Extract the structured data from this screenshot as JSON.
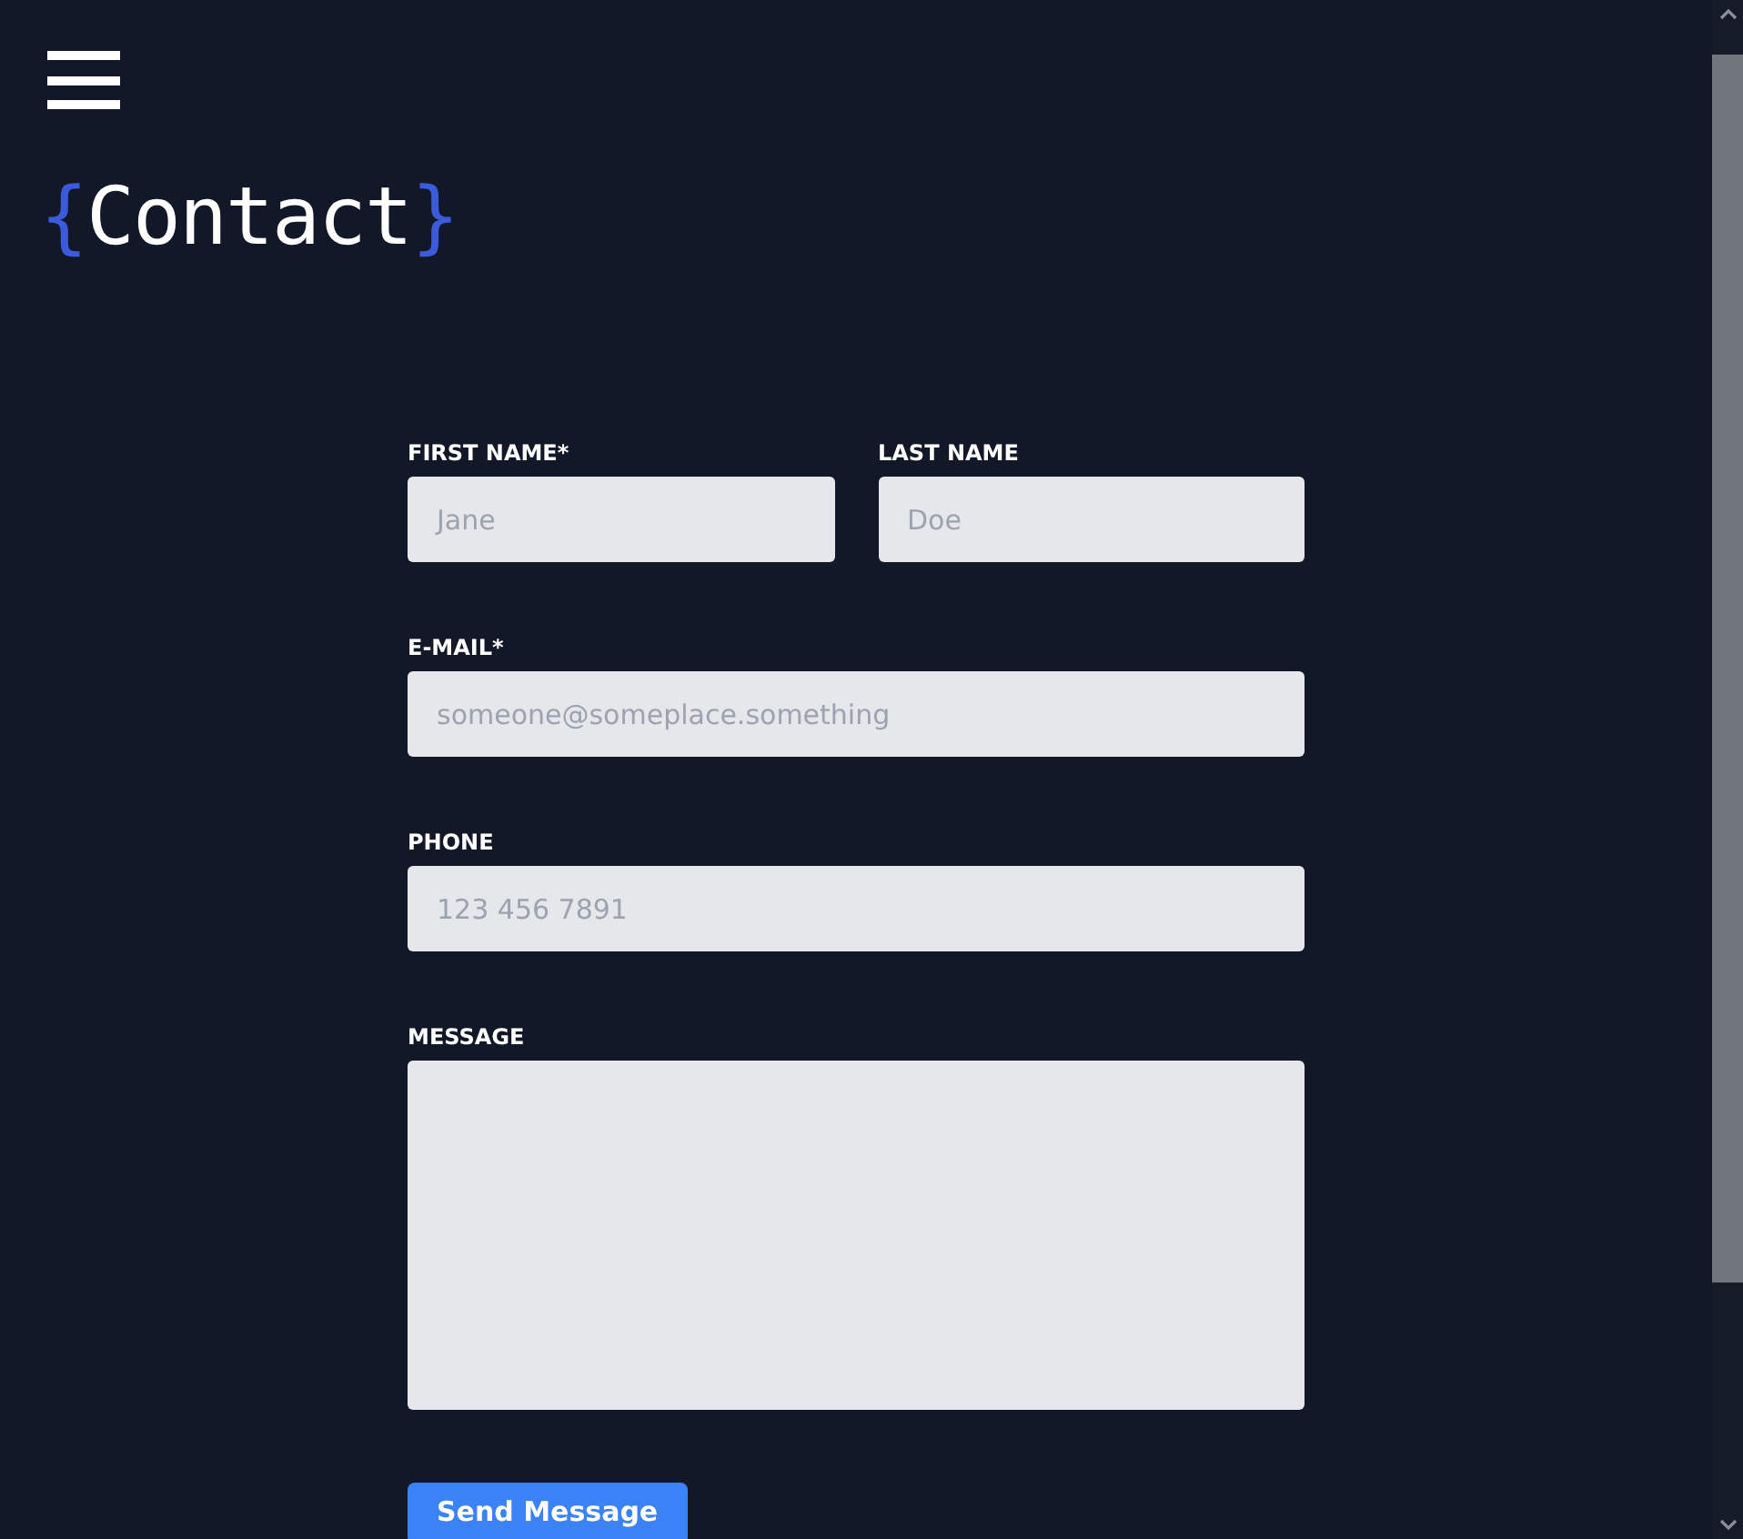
{
  "page_title": {
    "open_brace": "{",
    "text": "Contact",
    "close_brace": "}"
  },
  "form": {
    "rows": [
      [
        {
          "kind": "input",
          "label": "FIRST NAME*",
          "placeholder": "Jane"
        },
        {
          "kind": "input",
          "label": "LAST NAME",
          "placeholder": "Doe"
        }
      ],
      [
        {
          "kind": "input",
          "label": "E-MAIL*",
          "placeholder": "someone@someplace.something"
        }
      ],
      [
        {
          "kind": "input",
          "label": "PHONE",
          "placeholder": "123 456 7891"
        }
      ],
      [
        {
          "kind": "textarea",
          "label": "MESSAGE"
        }
      ]
    ],
    "submit": "Send Message"
  }
}
